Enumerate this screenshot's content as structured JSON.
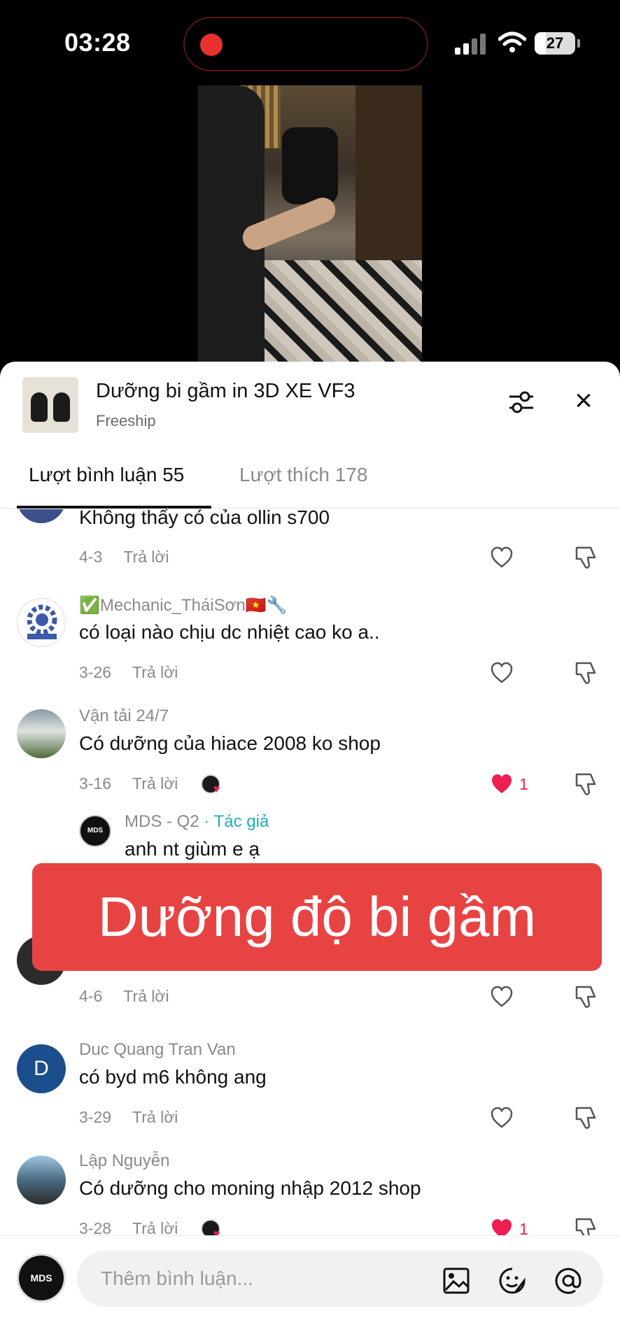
{
  "status_bar": {
    "time": "03:28",
    "battery": "27"
  },
  "product": {
    "title": "Dưỡng bi gầm in 3D XE VF3",
    "subtitle": "Freeship"
  },
  "tabs": [
    {
      "label": "Lượt bình luận 55"
    },
    {
      "label": "Lượt thích 178"
    }
  ],
  "reply_label": "Trả lời",
  "comments": [
    {
      "text": "Không thấy có của ollin s700",
      "date": "4-3"
    },
    {
      "user": "✅Mechanic_TháiSơn🇻🇳🔧",
      "text": "có loại nào chịu dc nhiệt cao ko a..",
      "date": "3-26"
    },
    {
      "user": "Vận tải 24/7",
      "text": "Có dưỡng của hiace 2008 ko shop",
      "date": "3-16",
      "likes": "1"
    },
    {
      "user": "MDS - Q2",
      "author_tag": " · Tác giả",
      "text": "anh nt giùm e ạ"
    },
    {
      "date": "4-6"
    },
    {
      "user": "Duc Quang Tran Van",
      "avatar_letter": "D",
      "text": "có byd m6 không ang",
      "date": "3-29"
    },
    {
      "user": "Lập Nguyễn",
      "text": "Có dưỡng cho moning nhập 2012 shop",
      "date": "3-28",
      "likes": "1"
    }
  ],
  "overlay_caption": "Dưỡng độ bi gầm",
  "composer": {
    "placeholder": "Thêm bình luận...",
    "avatar_text": "MDS"
  },
  "colors": {
    "like_red": "#ee1d52",
    "author_tag": "#20b0b4",
    "overlay": "#e84343"
  }
}
